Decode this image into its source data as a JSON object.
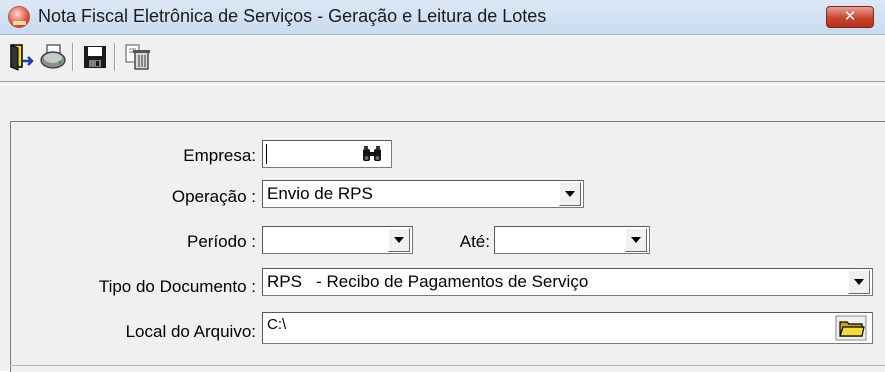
{
  "window": {
    "title": "Nota Fiscal Eletrônica de Serviços - Geração e Leitura de Lotes",
    "close_label": "✕"
  },
  "toolbar": {
    "buttons": [
      {
        "name": "exit-icon"
      },
      {
        "name": "print-icon"
      },
      {
        "name": "save-icon"
      },
      {
        "name": "delete-icon"
      }
    ]
  },
  "form": {
    "empresa": {
      "label": "Empresa:",
      "value": ""
    },
    "operacao": {
      "label": "Operação :",
      "value": "Envio de RPS"
    },
    "periodo": {
      "label": "Período :",
      "value": ""
    },
    "ate": {
      "label": "Até:",
      "value": ""
    },
    "tipo_documento": {
      "label": "Tipo do Documento :",
      "value": "RPS   - Recibo de Pagamentos de Serviço"
    },
    "local_arquivo": {
      "label": "Local do Arquivo:",
      "value": "C:\\"
    }
  }
}
